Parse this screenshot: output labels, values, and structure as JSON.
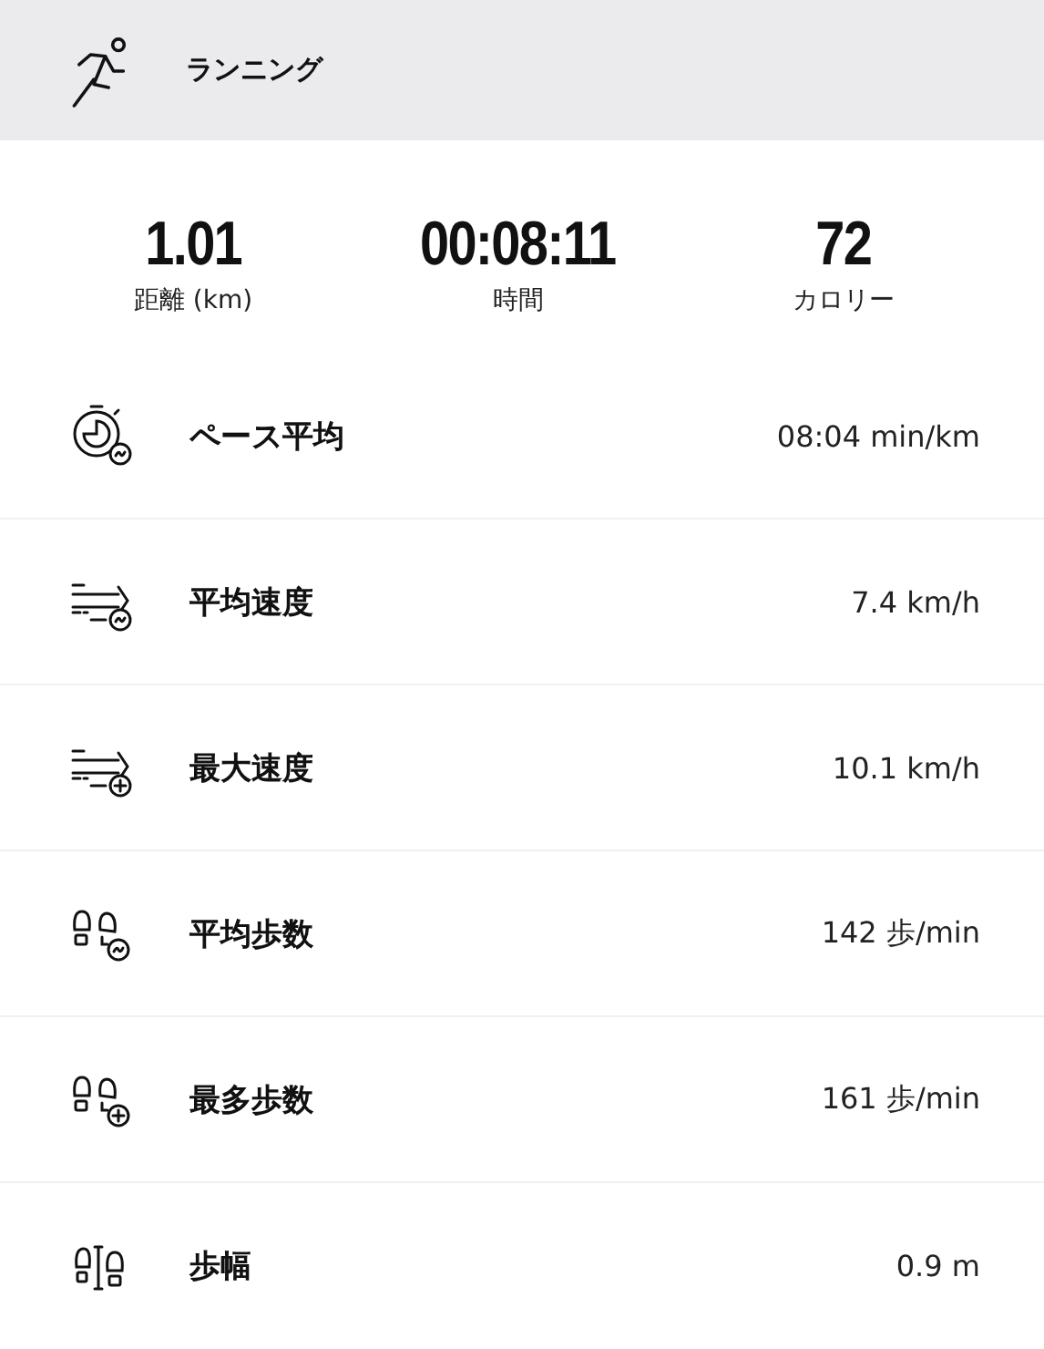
{
  "header": {
    "title": "ランニング"
  },
  "summary": [
    {
      "value": "1.01",
      "label": "距離 (km)"
    },
    {
      "value": "00:08:11",
      "label": "時間"
    },
    {
      "value": "72",
      "label": "カロリー"
    }
  ],
  "metrics": [
    {
      "kind": "pace",
      "label": "ペース平均",
      "value": "08:04 min/km"
    },
    {
      "kind": "speed-avg",
      "label": "平均速度",
      "value": "7.4 km/h"
    },
    {
      "kind": "speed-max",
      "label": "最大速度",
      "value": "10.1 km/h"
    },
    {
      "kind": "steps-avg",
      "label": "平均歩数",
      "value": "142 歩/min"
    },
    {
      "kind": "steps-max",
      "label": "最多歩数",
      "value": "161 歩/min"
    },
    {
      "kind": "stride",
      "label": "歩幅",
      "value": "0.9 m"
    }
  ]
}
